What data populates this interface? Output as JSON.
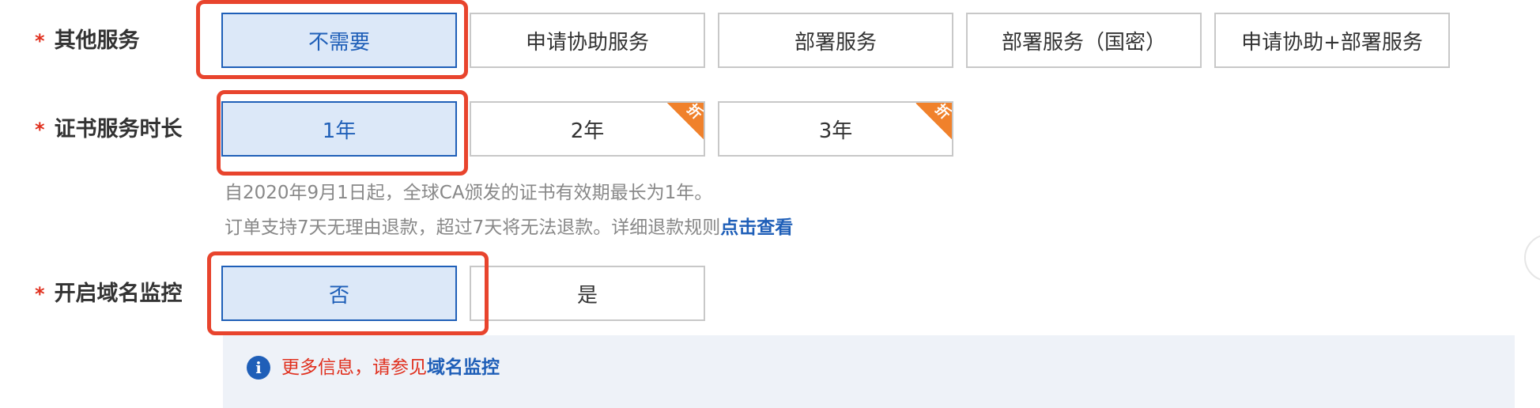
{
  "other_services": {
    "required_mark": "*",
    "label": "其他服务",
    "options": [
      "不需要",
      "申请协助服务",
      "部署服务",
      "部署服务（国密）",
      "申请协助+部署服务"
    ],
    "selected": "不需要"
  },
  "duration": {
    "required_mark": "*",
    "label": "证书服务时长",
    "options": [
      "1年",
      "2年",
      "3年"
    ],
    "selected": "1年",
    "discount_badge": "折",
    "note_validity": "自2020年9月1日起，全球CA颁发的证书有效期最长为1年。",
    "note_refund": "订单支持7天无理由退款，超过7天将无法退款。详细退款规则",
    "note_refund_link": "点击查看"
  },
  "monitoring": {
    "required_mark": "*",
    "label": "开启域名监控",
    "options": [
      "否",
      "是"
    ],
    "selected": "否",
    "info_icon": "info-icon",
    "info_text": "更多信息，请参见",
    "info_link": "域名监控"
  },
  "colors": {
    "accent": "#1f5fb8",
    "selected_bg": "#dce8f8",
    "required": "#e0301e",
    "highlight": "#e8442d",
    "discount": "#f0812b",
    "info_bg": "#eef2f8"
  }
}
